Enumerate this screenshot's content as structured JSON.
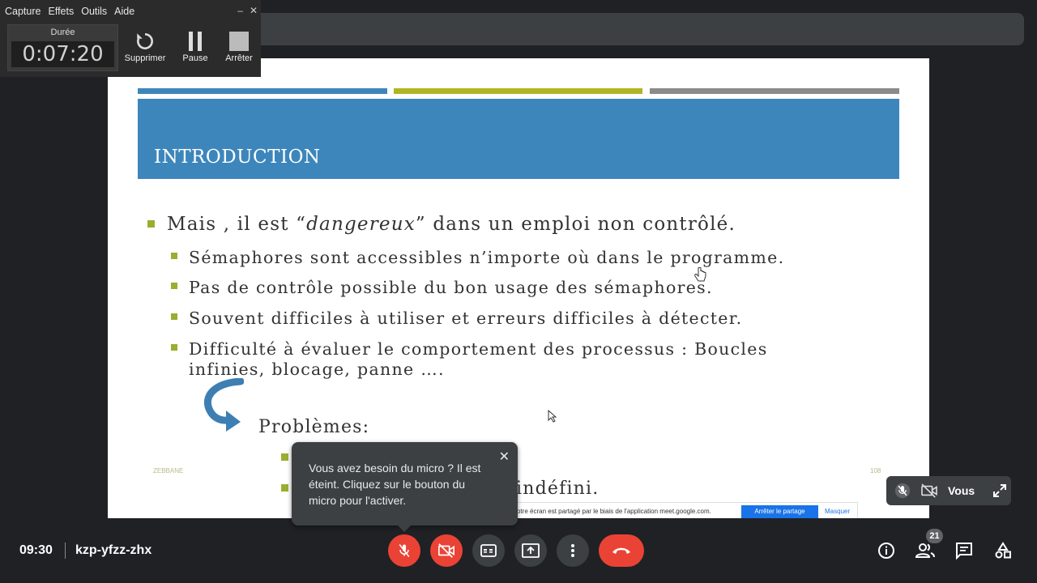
{
  "recorder": {
    "menu": [
      "Capture",
      "Effets",
      "Outils",
      "Aide"
    ],
    "duration_label": "Durée",
    "duration_value": "0:07:20",
    "buttons": {
      "delete": "Supprimer",
      "pause": "Pause",
      "stop": "Arrêter"
    }
  },
  "slide": {
    "title": "INTRODUCTION",
    "stripe_colors": [
      "#3d86bb",
      "#b1b524",
      "#8a8a8a"
    ],
    "accent_color": "#9aae2f",
    "bullet_main_before": "Mais , il est “",
    "bullet_main_em": "dangereux",
    "bullet_main_after": "” dans un emploi non contrôlé.",
    "sub_bullets": [
      "Sémaphores sont accessibles n’importe où dans le programme.",
      "Pas de contrôle possible du bon usage des sémaphores.",
      "Souvent difficiles à utiliser et erreurs difficiles à détecter.",
      "Difficulté à évaluer le comportement des processus : Boucles"
    ],
    "sub_bullet_continuation": "infinies, blocage, panne ….",
    "problems_label": "Problèmes:",
    "hidden_bullet_tail": "indéfini.",
    "footer_left": "ZEBBANE",
    "footer_right": "108"
  },
  "share_bar": {
    "text": "otre écran est partagé par le biais de l'application meet.google.com.",
    "stop_label": "Arrêter le partage",
    "hide_label": "Masquer"
  },
  "tooltip": {
    "message": "Vous avez besoin du micro ? Il est éteint. Cliquez sur le bouton du micro pour l'activer."
  },
  "self_tile": {
    "name": "Vous"
  },
  "meeting": {
    "time": "09:30",
    "code": "kzp-yfzz-zhx",
    "participant_count": "21"
  },
  "colors": {
    "danger": "#ea4335",
    "control_bg": "#3c4043",
    "page_bg": "#202124"
  }
}
